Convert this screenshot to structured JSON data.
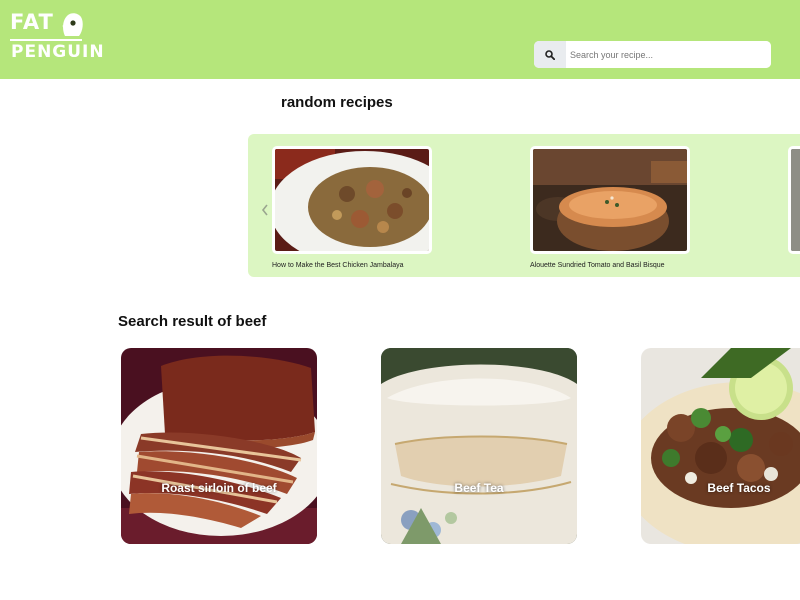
{
  "header": {
    "logo": {
      "line1": "FAT",
      "line2": "PENGUIN"
    },
    "search": {
      "placeholder": "Search your recipe...",
      "value": "",
      "icon": "search-icon"
    },
    "background_color": "#b5e67b"
  },
  "random": {
    "title": "random recipes",
    "items": [
      {
        "caption": "How to Make the Best Chicken Jambalaya"
      },
      {
        "caption": "Alouette Sundried Tomato and Basil Bisque"
      }
    ],
    "panel_color": "#dcf6c2"
  },
  "results": {
    "title": "Search result of beef",
    "items": [
      {
        "label": "Roast sirloin of beef"
      },
      {
        "label": "Beef Tea"
      },
      {
        "label": "Beef Tacos"
      }
    ]
  }
}
